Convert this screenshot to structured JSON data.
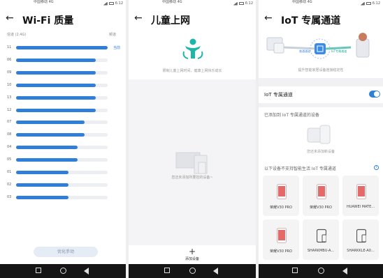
{
  "colors": {
    "accent": "#2f7fd8",
    "track": "#eceef1"
  },
  "wifi": {
    "status": {
      "carrier": "中国移动 4G",
      "time": "6:12"
    },
    "title": "Wi-Fi 质量",
    "header_left": "信道 (2.4G)",
    "header_right": "频道",
    "channels": [
      {
        "num": "11",
        "fill": 1.0,
        "tag": "当前"
      },
      {
        "num": "06",
        "fill": 0.87,
        "tag": ""
      },
      {
        "num": "09",
        "fill": 0.87,
        "tag": ""
      },
      {
        "num": "10",
        "fill": 0.87,
        "tag": ""
      },
      {
        "num": "13",
        "fill": 0.87,
        "tag": ""
      },
      {
        "num": "12",
        "fill": 0.87,
        "tag": ""
      },
      {
        "num": "07",
        "fill": 0.75,
        "tag": ""
      },
      {
        "num": "08",
        "fill": 0.75,
        "tag": ""
      },
      {
        "num": "04",
        "fill": 0.67,
        "tag": ""
      },
      {
        "num": "05",
        "fill": 0.67,
        "tag": ""
      },
      {
        "num": "01",
        "fill": 0.57,
        "tag": ""
      },
      {
        "num": "02",
        "fill": 0.57,
        "tag": ""
      },
      {
        "num": "03",
        "fill": 0.57,
        "tag": ""
      }
    ],
    "optimize_button": "优化手动"
  },
  "kids": {
    "status": {
      "carrier": "中国移动 4G",
      "time": "6:12"
    },
    "title": "儿童上网",
    "description": "限制儿童上网时间，健康上网快乐成长",
    "empty_text": "您还未添加所要控的设备~",
    "add_label": "添加设备",
    "add_icon": "plus-icon"
  },
  "iot": {
    "status": {
      "carrier": "中国移动 4G",
      "time": "6:12"
    },
    "title": "IoT 专属通道",
    "banner_labels": [
      "普通通道",
      "IoT专属通道"
    ],
    "banner_caption": "提升智能家居设备连接稳定性",
    "toggle_label": "IoT 专属通道",
    "toggle_on": true,
    "added_section": "已添加到 IoT 专属通道的设备",
    "added_empty": "您还未添加新设备",
    "unsupported_section": "以下设备不支持智能生活 IoT 专属通道",
    "devices": [
      {
        "name": "荣耀V30 PRO",
        "type": "phone-red"
      },
      {
        "name": "荣耀V30 PRO",
        "type": "phone-red"
      },
      {
        "name": "HUAWEI MATE...",
        "type": "phone-red"
      },
      {
        "name": "荣耀V30 PRO",
        "type": "phone-red"
      },
      {
        "name": "SHARKMBU-A...",
        "type": "phone-outline"
      },
      {
        "name": "SHARKKLE-A0...",
        "type": "phone-outline"
      }
    ]
  }
}
